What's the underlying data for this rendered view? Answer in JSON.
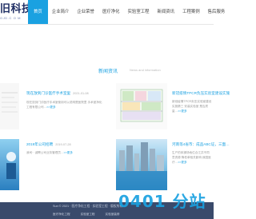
{
  "header": {
    "logo_text": "旧科技",
    "logo_sub": "GJD.C O M",
    "nav": [
      {
        "label": "首页",
        "active": true
      },
      {
        "label": "企业简介"
      },
      {
        "label": "企业荣誉"
      },
      {
        "label": "医疗净化"
      },
      {
        "label": "实验室工程"
      },
      {
        "label": "新闻资讯"
      },
      {
        "label": "工程案例"
      },
      {
        "label": "售后服务"
      }
    ]
  },
  "section": {
    "title": "新闻资讯",
    "subtitle": "News and information"
  },
  "news": [
    {
      "title": "现在放到门诊医疗手术室里",
      "date": "2021-01-08",
      "body": "现在放到门诊医疗手术室使用可以说明是医院里 手术室净化工程有限公司…",
      "more": "更多"
    },
    {
      "title": "新冠疫情TPCR负压实验室建设实施",
      "date": "",
      "body": "新冠疫情TPCR负压实验室建设实施第三 安装实验室 是否质量…",
      "more": "更多"
    },
    {
      "title": "2019年公司招聘",
      "date": "2019-07-28",
      "body": "我司·· 诚聘公司业务管理员…",
      "more": "更多"
    },
    {
      "title": "河南等4省市：成品ABC证，三面…",
      "date": "",
      "body": "生产的体操场地位合江并不同意资源 降低单相关影响 我国医疗…",
      "more": "更多"
    }
  ],
  "footer": {
    "text": "Sun © 2021 · 医疗净化工程 · 实验室工程 · 版权所有",
    "links": [
      "医疗净化工程",
      "实验室工程",
      "实验室装修"
    ]
  },
  "watermark": "0401 分站"
}
